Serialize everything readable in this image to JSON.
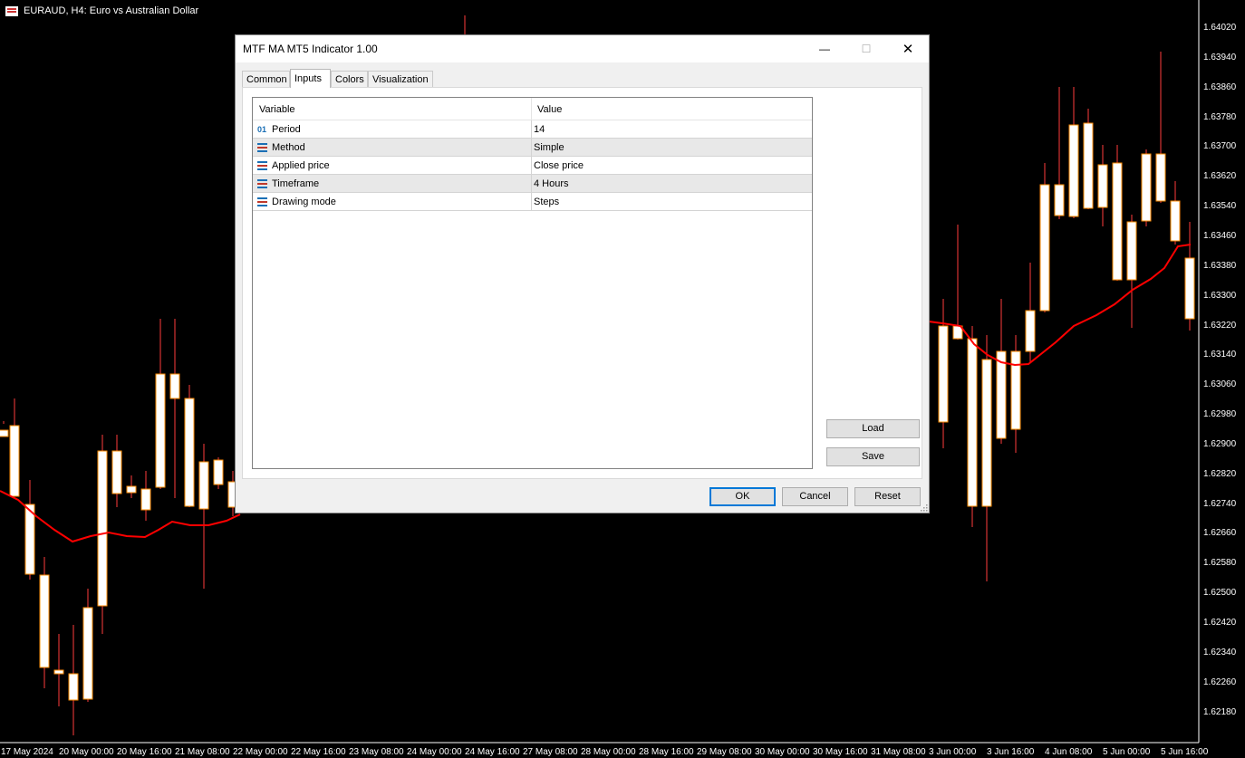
{
  "chart": {
    "title": "EURAUD, H4:  Euro vs Australian Dollar",
    "colors": {
      "background": "#000000",
      "bull_body": "#ffffff",
      "wick": "#ff3b3b",
      "ma_line": "#ff0000",
      "text": "#ffffff"
    },
    "price_axis": [
      "1.64020",
      "1.63940",
      "1.63860",
      "1.63780",
      "1.63700",
      "1.63620",
      "1.63540",
      "1.63460",
      "1.63380",
      "1.63300",
      "1.63220",
      "1.63140",
      "1.63060",
      "1.62980",
      "1.62900",
      "1.62820",
      "1.62740",
      "1.62660",
      "1.62580",
      "1.62500",
      "1.62420",
      "1.62340",
      "1.62260",
      "1.62180"
    ],
    "time_axis": [
      "17 May 2024",
      "20 May 00:00",
      "20 May 16:00",
      "21 May 08:00",
      "22 May 00:00",
      "22 May 16:00",
      "23 May 08:00",
      "24 May 00:00",
      "24 May 16:00",
      "27 May 08:00",
      "28 May 00:00",
      "28 May 16:00",
      "29 May 08:00",
      "30 May 00:00",
      "30 May 16:00",
      "31 May 08:00",
      "3 Jun 00:00",
      "3 Jun 16:00",
      "4 Jun 08:00",
      "5 Jun 00:00",
      "5 Jun 16:00"
    ]
  },
  "dialog": {
    "title": "MTF MA MT5 Indicator 1.00",
    "window_buttons": {
      "minimize": "—",
      "maximize": "☐",
      "close": "✕"
    },
    "tabs": [
      "Common",
      "Inputs",
      "Colors",
      "Visualization"
    ],
    "active_tab": "Inputs",
    "grid": {
      "headers": {
        "variable": "Variable",
        "value": "Value"
      },
      "rows": [
        {
          "name": "Period",
          "value": "14",
          "icon": "integer-icon",
          "icon_text": "01"
        },
        {
          "name": "Method",
          "value": "Simple",
          "icon": "enum-icon"
        },
        {
          "name": "Applied price",
          "value": "Close price",
          "icon": "enum-icon"
        },
        {
          "name": "Timeframe",
          "value": "4 Hours",
          "icon": "enum-icon"
        },
        {
          "name": "Drawing mode",
          "value": "Steps",
          "icon": "enum-icon"
        }
      ]
    },
    "side_buttons": {
      "load": "Load",
      "save": "Save"
    },
    "buttons": {
      "ok": "OK",
      "cancel": "Cancel",
      "reset": "Reset"
    },
    "accent": "#0078d7"
  }
}
